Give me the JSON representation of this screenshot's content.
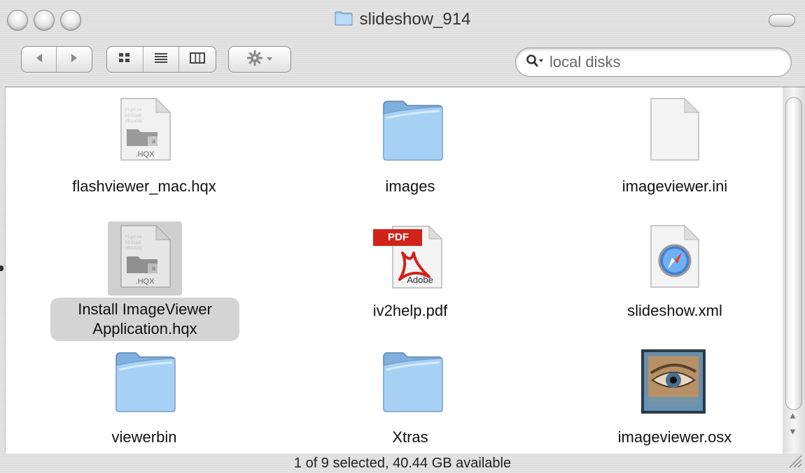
{
  "window": {
    "title": "slideshow_914"
  },
  "toolbar": {
    "back_icon": "back-arrow-icon",
    "forward_icon": "forward-arrow-icon",
    "views": [
      "icon-view-icon",
      "list-view-icon",
      "column-view-icon"
    ],
    "action_icon": "gear-icon",
    "search": {
      "scope_icon": "search-icon",
      "placeholder": "local disks"
    }
  },
  "items": [
    {
      "name": "flashviewer_mac.hqx",
      "icon": "hqx-file-icon",
      "icon_caption": ".HQX"
    },
    {
      "name": "images",
      "icon": "folder-icon"
    },
    {
      "name": "imageviewer.ini",
      "icon": "blank-document-icon"
    },
    {
      "name": "Install ImageViewer Application.hqx",
      "name_line1": "Install ImageViewer",
      "name_line2": "Application.hqx",
      "icon": "hqx-file-icon",
      "icon_caption": ".HQX",
      "selected": true
    },
    {
      "name": "iv2help.pdf",
      "icon": "pdf-document-icon",
      "badge": "PDF",
      "brand": "Adobe"
    },
    {
      "name": "slideshow.xml",
      "icon": "safari-document-icon"
    },
    {
      "name": "viewerbin",
      "icon": "folder-icon"
    },
    {
      "name": "Xtras",
      "icon": "folder-icon"
    },
    {
      "name": "imageviewer.osx",
      "icon": "application-eye-icon"
    }
  ],
  "status": {
    "text": "1 of 9 selected, 40.44 GB available"
  },
  "colors": {
    "folder_blue": "#8fc0ec",
    "pdf_red": "#d0231a",
    "selection_gray": "#d4d4d4"
  }
}
